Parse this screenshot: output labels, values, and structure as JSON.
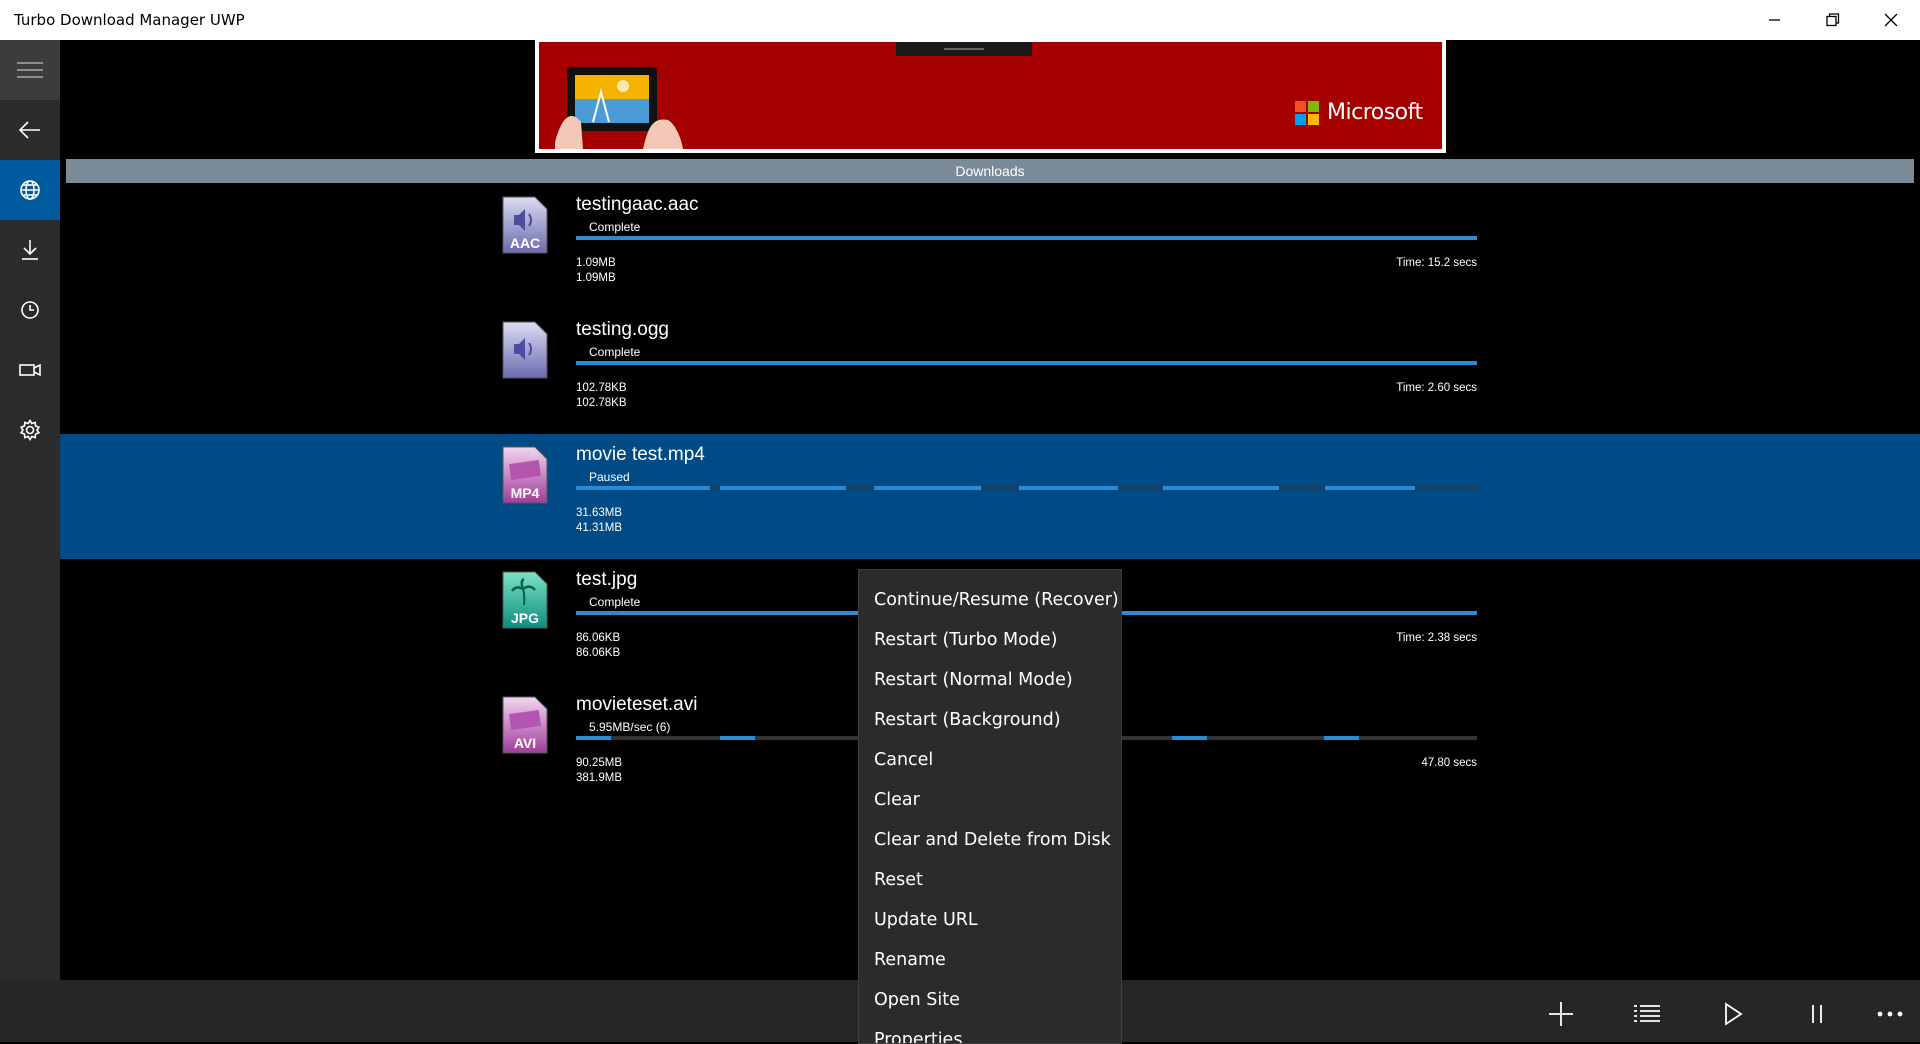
{
  "window": {
    "title": "Turbo Download Manager UWP",
    "minimize_icon": "minimize-icon",
    "restore_icon": "restore-icon",
    "close_icon": "close-icon"
  },
  "sidebar": {
    "items": [
      {
        "name": "hamburger-menu",
        "icon": "hamburger-icon"
      },
      {
        "name": "back",
        "icon": "back-arrow-icon"
      },
      {
        "name": "browser",
        "icon": "globe-icon",
        "active": true
      },
      {
        "name": "downloads",
        "icon": "download-icon"
      },
      {
        "name": "history",
        "icon": "clock-icon"
      },
      {
        "name": "video",
        "icon": "video-camera-icon"
      },
      {
        "name": "settings",
        "icon": "gear-icon"
      }
    ]
  },
  "ad": {
    "brand": "Microsoft",
    "colors": {
      "background": "#a50000",
      "red": "#f25022",
      "green": "#7fba00",
      "blue": "#00a4ef",
      "yellow": "#ffb900"
    }
  },
  "list": {
    "header": "Downloads",
    "items": [
      {
        "filename": "testingaac.aac",
        "status": "Complete",
        "icon_label": "AAC",
        "icon": "audio-file-icon",
        "downloaded": "1.09MB",
        "total": "1.09MB",
        "time": "Time: 15.2 secs",
        "progress": 1.0
      },
      {
        "filename": "testing.ogg",
        "status": "Complete",
        "icon_label": "",
        "icon": "audio-file-icon",
        "downloaded": "102.78KB",
        "total": "102.78KB",
        "time": "Time: 2.60 secs",
        "progress": 1.0
      },
      {
        "filename": "movie test.mp4",
        "status": "Paused",
        "icon_label": "MP4",
        "icon": "video-file-icon",
        "downloaded": "31.63MB",
        "total": "41.31MB",
        "time": "",
        "progress": 0.766,
        "selected": true
      },
      {
        "filename": "test.jpg",
        "status": "Complete",
        "icon_label": "JPG",
        "icon": "image-file-icon",
        "downloaded": "86.06KB",
        "total": "86.06KB",
        "time": "Time: 2.38 secs",
        "progress": 1.0
      },
      {
        "filename": "movieteset.avi",
        "status": "5.95MB/sec (6)",
        "icon_label": "AVI",
        "icon": "video-file-icon",
        "downloaded": "90.25MB",
        "total": "381.9MB",
        "time": "47.80 secs",
        "progress": 0.236
      }
    ]
  },
  "context_menu": {
    "items": [
      "Continue/Resume (Recover)",
      "Restart (Turbo Mode)",
      "Restart (Normal Mode)",
      "Restart (Background)",
      "Cancel",
      "Clear",
      "Clear and Delete from Disk",
      "Reset",
      "Update URL",
      "Rename",
      "Open Site",
      "Properties"
    ]
  },
  "bottom_bar": {
    "buttons": [
      {
        "name": "add",
        "icon": "plus-icon"
      },
      {
        "name": "select-list",
        "icon": "list-icon"
      },
      {
        "name": "start",
        "icon": "play-icon"
      },
      {
        "name": "pause",
        "icon": "pause-icon"
      },
      {
        "name": "more",
        "icon": "more-icon"
      }
    ]
  }
}
